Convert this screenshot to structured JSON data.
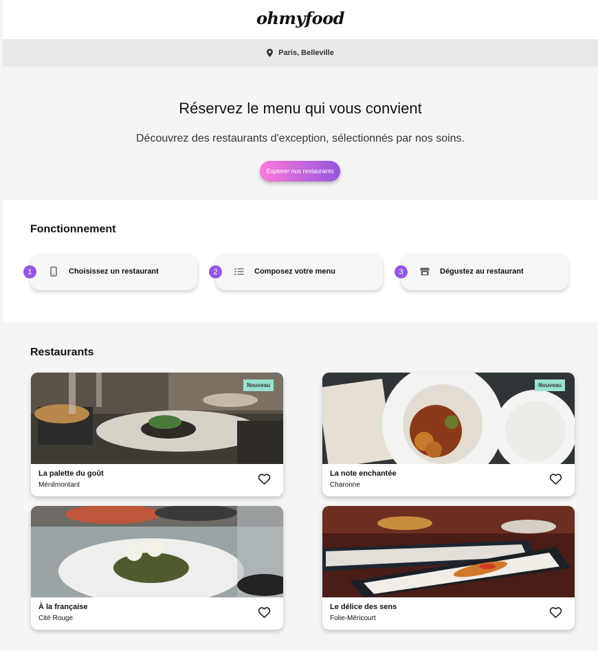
{
  "header": {
    "logo": "ohmyfood"
  },
  "location": {
    "icon": "location-pin-icon",
    "text": "Paris, Belleville"
  },
  "hero": {
    "title": "Réservez le menu qui vous convient",
    "subtitle": "Découvrez des restaurants d'exception, sélectionnés par nos soins.",
    "button_label": "Explorer nos restaurants",
    "button_gradient": [
      "#ff79da",
      "#9356dc"
    ]
  },
  "how": {
    "title": "Fonctionnement",
    "steps": [
      {
        "number": "1",
        "icon": "phone-icon",
        "label": "Choisissez un restaurant"
      },
      {
        "number": "2",
        "icon": "list-icon",
        "label": "Composez votre menu"
      },
      {
        "number": "3",
        "icon": "store-icon",
        "label": "Dégustez au restaurant"
      }
    ]
  },
  "restaurants": {
    "title": "Restaurants",
    "items": [
      {
        "name": "La palette du goût",
        "location": "Ménilmontant",
        "badge": "Nouveau"
      },
      {
        "name": "La note enchantée",
        "location": "Charonne",
        "badge": "Nouveau"
      },
      {
        "name": "À la française",
        "location": "Cité Rouge"
      },
      {
        "name": "Le délice des sens",
        "location": "Folie-Méricourt"
      }
    ]
  },
  "colors": {
    "accent": "#9356dc",
    "badge": "#99e2d0",
    "background": "#f5f5f5"
  }
}
